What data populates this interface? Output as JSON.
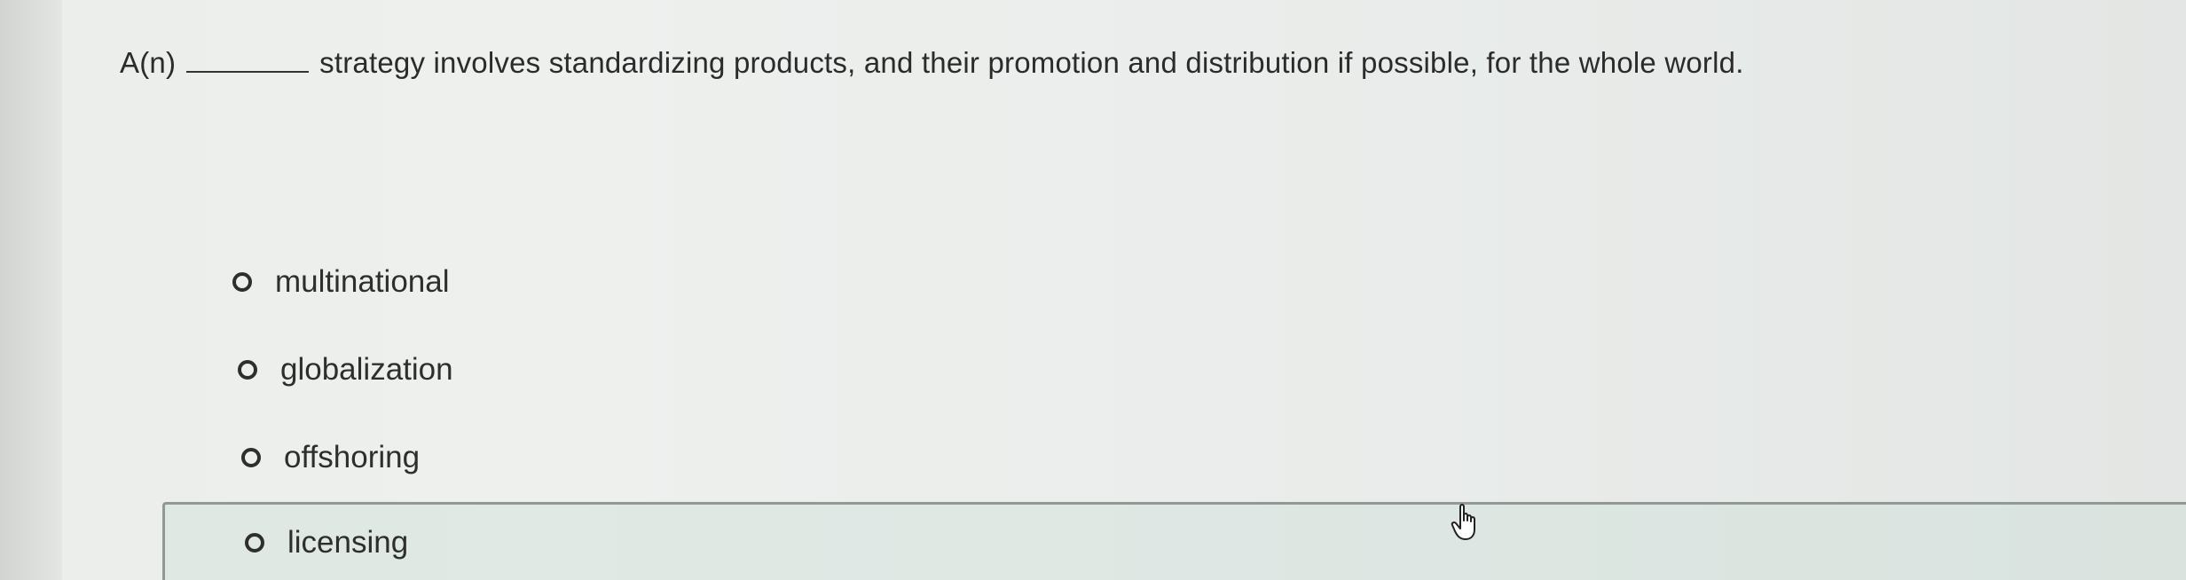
{
  "question": {
    "prefix": "A(n)",
    "text": "strategy involves standardizing products, and their promotion and distribution if possible, for the whole world."
  },
  "options": [
    {
      "label": "multinational",
      "selected": false
    },
    {
      "label": "globalization",
      "selected": false
    },
    {
      "label": "offshoring",
      "selected": false
    },
    {
      "label": "licensing",
      "selected": false,
      "hovered": true
    }
  ],
  "icons": {
    "radio": "radio-button-icon",
    "cursor": "hand-pointer-icon"
  }
}
